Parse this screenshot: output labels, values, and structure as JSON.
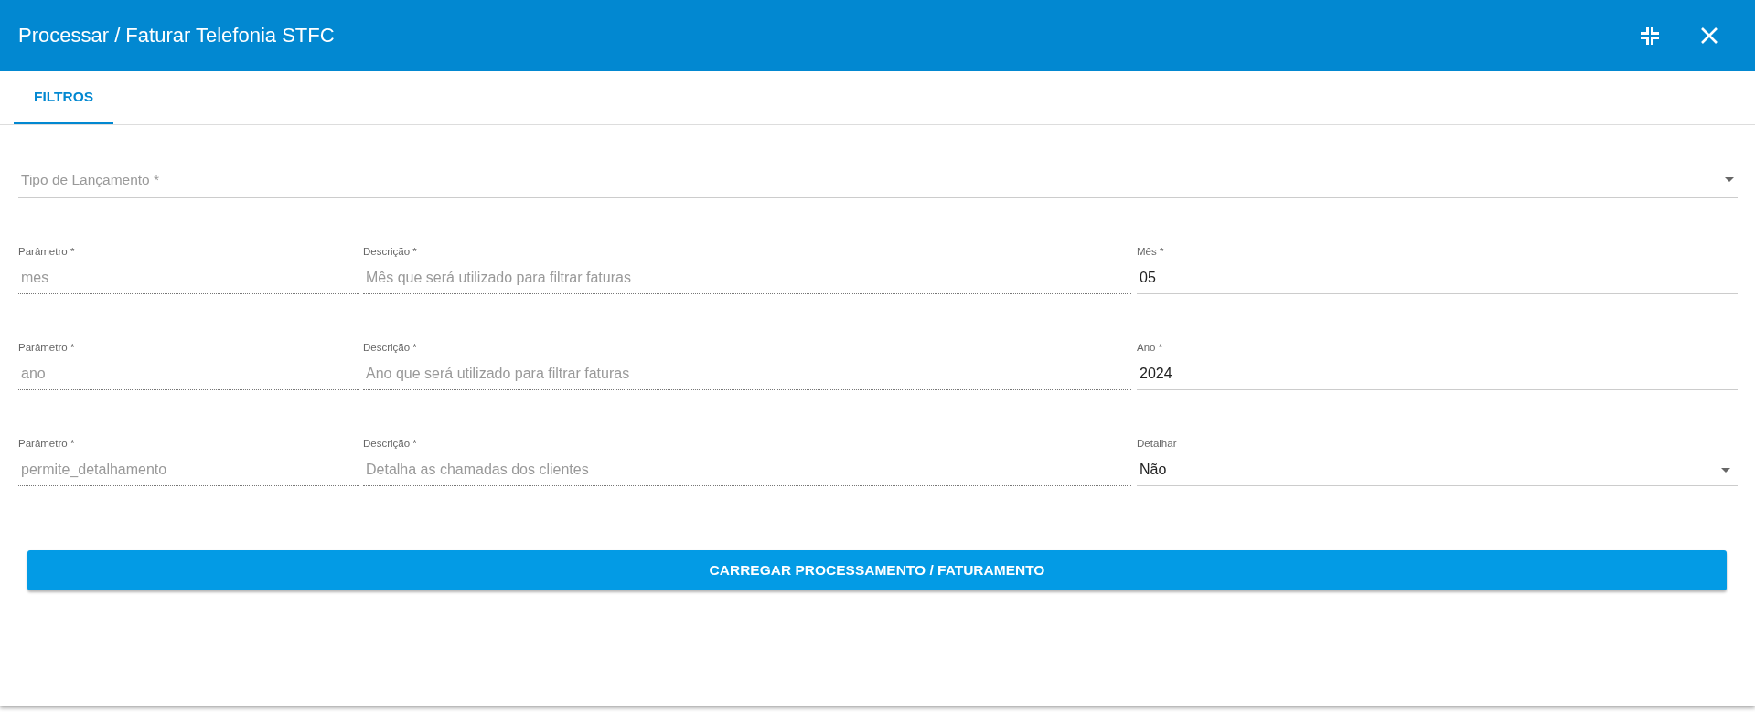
{
  "window": {
    "title": "Processar / Faturar Telefonia STFC"
  },
  "header_buttons": [
    {
      "kind": "collapse"
    },
    {
      "kind": "close"
    }
  ],
  "tabs": [
    {
      "label": "FILTROS",
      "selected": true
    }
  ],
  "tipo_lancamento": {
    "placeholder": "Tipo de Lançamento *",
    "kind": "select"
  },
  "parameter_rows": [
    {
      "fields": [
        {
          "label": "Parâmetro *",
          "value": "mes",
          "disabled": true,
          "kind": "input"
        },
        {
          "label": "Descrição *",
          "value": "Mês que será utilizado para filtrar faturas",
          "disabled": true,
          "kind": "input"
        },
        {
          "label": "Mês *",
          "value": "05",
          "disabled": false,
          "kind": "input"
        }
      ]
    },
    {
      "fields": [
        {
          "label": "Parâmetro *",
          "value": "ano",
          "disabled": true,
          "kind": "input"
        },
        {
          "label": "Descrição *",
          "value": "Ano que será utilizado para filtrar faturas",
          "disabled": true,
          "kind": "input"
        },
        {
          "label": "Ano *",
          "value": "2024",
          "disabled": false,
          "kind": "input"
        }
      ]
    },
    {
      "fields": [
        {
          "label": "Parâmetro *",
          "value": "permite_detalhamento",
          "disabled": true,
          "kind": "input"
        },
        {
          "label": "Descrição *",
          "value": "Detalha as chamadas dos clientes",
          "disabled": true,
          "kind": "input"
        },
        {
          "label": "Detalhar",
          "value": "Não",
          "disabled": false,
          "kind": "select"
        }
      ]
    }
  ],
  "submit_button": {
    "label": "CARREGAR PROCESSAMENTO / FATURAMENTO"
  }
}
